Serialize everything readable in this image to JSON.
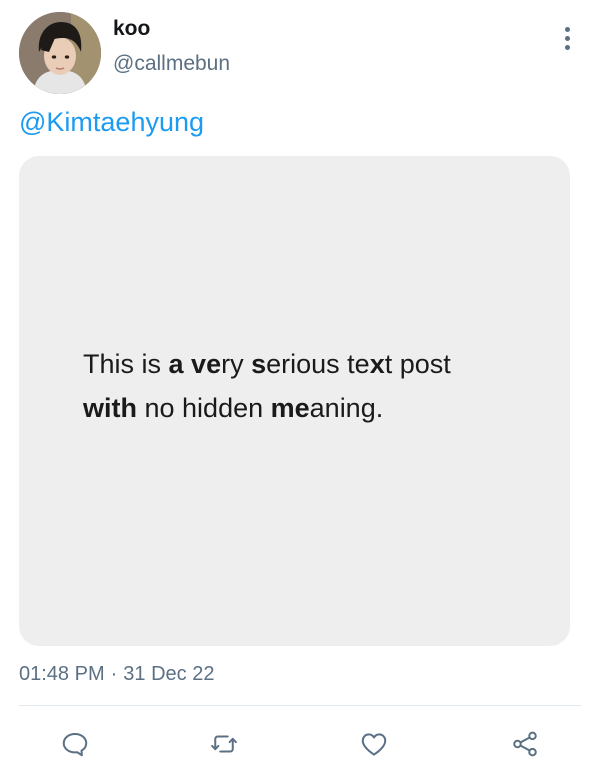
{
  "post": {
    "display_name": "koo",
    "handle": "@callmebun",
    "mention": "@Kimtaehyung",
    "media_text": {
      "line1": [
        {
          "text": "This",
          "bold": false
        },
        {
          "text": " is ",
          "bold": false
        },
        {
          "text": "a ve",
          "bold": true
        },
        {
          "text": "ry ",
          "bold": false
        },
        {
          "text": "s",
          "bold": true
        },
        {
          "text": "erious ",
          "bold": false
        },
        {
          "text": "te",
          "bold": false
        },
        {
          "text": "x",
          "bold": true
        },
        {
          "text": "t post",
          "bold": false
        }
      ],
      "line2": [
        {
          "text": "with",
          "bold": true
        },
        {
          "text": " no hidden ",
          "bold": false
        },
        {
          "text": "me",
          "bold": true
        },
        {
          "text": "aning.",
          "bold": false
        }
      ]
    },
    "time": "01:48 PM",
    "separator": "·",
    "date": "31 Dec 22"
  },
  "actions": {
    "reply_icon": "speech-bubble-icon",
    "retweet_icon": "retweet-arrows-icon",
    "like_icon": "heart-icon",
    "share_icon": "share-nodes-icon"
  },
  "colors": {
    "link": "#1d9bf0",
    "secondary_text": "#5b7083",
    "media_background": "#eeeeee",
    "divider": "#e1e8ed"
  }
}
